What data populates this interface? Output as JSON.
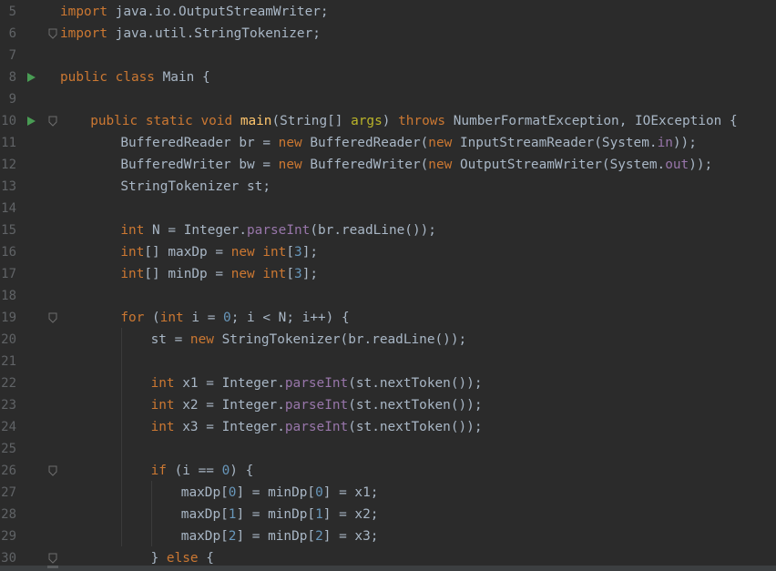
{
  "editor": {
    "lines": [
      {
        "n": "5",
        "indent": 0,
        "run": false,
        "fold": false,
        "tokens": [
          {
            "c": "k",
            "v": "import "
          },
          {
            "c": "t",
            "v": "java.io.OutputStreamWriter;"
          }
        ]
      },
      {
        "n": "6",
        "indent": 0,
        "run": false,
        "fold": true,
        "tokens": [
          {
            "c": "k",
            "v": "import "
          },
          {
            "c": "t",
            "v": "java.util.StringTokenizer;"
          }
        ]
      },
      {
        "n": "7",
        "indent": 0,
        "run": false,
        "fold": false,
        "tokens": []
      },
      {
        "n": "8",
        "indent": 0,
        "run": true,
        "fold": false,
        "tokens": [
          {
            "c": "k",
            "v": "public class "
          },
          {
            "c": "t",
            "v": "Main {"
          }
        ]
      },
      {
        "n": "9",
        "indent": 0,
        "run": false,
        "fold": false,
        "tokens": []
      },
      {
        "n": "10",
        "indent": 1,
        "run": true,
        "fold": true,
        "tokens": [
          {
            "c": "k",
            "v": "public static void "
          },
          {
            "c": "f",
            "v": "main"
          },
          {
            "c": "t",
            "v": "(String[] "
          },
          {
            "c": "p",
            "v": "args"
          },
          {
            "c": "t",
            "v": ") "
          },
          {
            "c": "k",
            "v": "throws "
          },
          {
            "c": "t",
            "v": "NumberFormatException, IOException {"
          }
        ]
      },
      {
        "n": "11",
        "indent": 2,
        "run": false,
        "fold": false,
        "tokens": [
          {
            "c": "t",
            "v": "BufferedReader br = "
          },
          {
            "c": "k",
            "v": "new "
          },
          {
            "c": "t",
            "v": "BufferedReader("
          },
          {
            "c": "k",
            "v": "new "
          },
          {
            "c": "t",
            "v": "InputStreamReader(System."
          },
          {
            "c": "s",
            "v": "in"
          },
          {
            "c": "t",
            "v": "));"
          }
        ]
      },
      {
        "n": "12",
        "indent": 2,
        "run": false,
        "fold": false,
        "tokens": [
          {
            "c": "t",
            "v": "BufferedWriter bw = "
          },
          {
            "c": "k",
            "v": "new "
          },
          {
            "c": "t",
            "v": "BufferedWriter("
          },
          {
            "c": "k",
            "v": "new "
          },
          {
            "c": "t",
            "v": "OutputStreamWriter(System."
          },
          {
            "c": "s",
            "v": "out"
          },
          {
            "c": "t",
            "v": "));"
          }
        ]
      },
      {
        "n": "13",
        "indent": 2,
        "run": false,
        "fold": false,
        "tokens": [
          {
            "c": "t",
            "v": "StringTokenizer st;"
          }
        ]
      },
      {
        "n": "14",
        "indent": 0,
        "run": false,
        "fold": false,
        "tokens": []
      },
      {
        "n": "15",
        "indent": 2,
        "run": false,
        "fold": false,
        "tokens": [
          {
            "c": "k",
            "v": "int "
          },
          {
            "c": "t",
            "v": "N = Integer."
          },
          {
            "c": "s",
            "v": "parseInt"
          },
          {
            "c": "t",
            "v": "(br.readLine());"
          }
        ]
      },
      {
        "n": "16",
        "indent": 2,
        "run": false,
        "fold": false,
        "tokens": [
          {
            "c": "k",
            "v": "int"
          },
          {
            "c": "t",
            "v": "[] maxDp = "
          },
          {
            "c": "k",
            "v": "new int"
          },
          {
            "c": "t",
            "v": "["
          },
          {
            "c": "n",
            "v": "3"
          },
          {
            "c": "t",
            "v": "];"
          }
        ]
      },
      {
        "n": "17",
        "indent": 2,
        "run": false,
        "fold": false,
        "tokens": [
          {
            "c": "k",
            "v": "int"
          },
          {
            "c": "t",
            "v": "[] minDp = "
          },
          {
            "c": "k",
            "v": "new int"
          },
          {
            "c": "t",
            "v": "["
          },
          {
            "c": "n",
            "v": "3"
          },
          {
            "c": "t",
            "v": "];"
          }
        ]
      },
      {
        "n": "18",
        "indent": 0,
        "run": false,
        "fold": false,
        "tokens": []
      },
      {
        "n": "19",
        "indent": 2,
        "run": false,
        "fold": true,
        "tokens": [
          {
            "c": "k",
            "v": "for "
          },
          {
            "c": "t",
            "v": "("
          },
          {
            "c": "k",
            "v": "int "
          },
          {
            "c": "t",
            "v": "i = "
          },
          {
            "c": "n",
            "v": "0"
          },
          {
            "c": "t",
            "v": "; i < N; i++) {"
          }
        ]
      },
      {
        "n": "20",
        "indent": 3,
        "run": false,
        "fold": false,
        "tokens": [
          {
            "c": "t",
            "v": "st = "
          },
          {
            "c": "k",
            "v": "new "
          },
          {
            "c": "t",
            "v": "StringTokenizer(br.readLine());"
          }
        ]
      },
      {
        "n": "21",
        "indent": 0,
        "run": false,
        "fold": false,
        "tokens": []
      },
      {
        "n": "22",
        "indent": 3,
        "run": false,
        "fold": false,
        "tokens": [
          {
            "c": "k",
            "v": "int "
          },
          {
            "c": "t",
            "v": "x1 = Integer."
          },
          {
            "c": "s",
            "v": "parseInt"
          },
          {
            "c": "t",
            "v": "(st.nextToken());"
          }
        ]
      },
      {
        "n": "23",
        "indent": 3,
        "run": false,
        "fold": false,
        "tokens": [
          {
            "c": "k",
            "v": "int "
          },
          {
            "c": "t",
            "v": "x2 = Integer."
          },
          {
            "c": "s",
            "v": "parseInt"
          },
          {
            "c": "t",
            "v": "(st.nextToken());"
          }
        ]
      },
      {
        "n": "24",
        "indent": 3,
        "run": false,
        "fold": false,
        "tokens": [
          {
            "c": "k",
            "v": "int "
          },
          {
            "c": "t",
            "v": "x3 = Integer."
          },
          {
            "c": "s",
            "v": "parseInt"
          },
          {
            "c": "t",
            "v": "(st.nextToken());"
          }
        ]
      },
      {
        "n": "25",
        "indent": 0,
        "run": false,
        "fold": false,
        "tokens": []
      },
      {
        "n": "26",
        "indent": 3,
        "run": false,
        "fold": true,
        "tokens": [
          {
            "c": "k",
            "v": "if "
          },
          {
            "c": "t",
            "v": "(i == "
          },
          {
            "c": "n",
            "v": "0"
          },
          {
            "c": "t",
            "v": ") {"
          }
        ]
      },
      {
        "n": "27",
        "indent": 4,
        "run": false,
        "fold": false,
        "tokens": [
          {
            "c": "t",
            "v": "maxDp["
          },
          {
            "c": "n",
            "v": "0"
          },
          {
            "c": "t",
            "v": "] = minDp["
          },
          {
            "c": "n",
            "v": "0"
          },
          {
            "c": "t",
            "v": "] = x1;"
          }
        ]
      },
      {
        "n": "28",
        "indent": 4,
        "run": false,
        "fold": false,
        "tokens": [
          {
            "c": "t",
            "v": "maxDp["
          },
          {
            "c": "n",
            "v": "1"
          },
          {
            "c": "t",
            "v": "] = minDp["
          },
          {
            "c": "n",
            "v": "1"
          },
          {
            "c": "t",
            "v": "] = x2;"
          }
        ]
      },
      {
        "n": "29",
        "indent": 4,
        "run": false,
        "fold": false,
        "tokens": [
          {
            "c": "t",
            "v": "maxDp["
          },
          {
            "c": "n",
            "v": "2"
          },
          {
            "c": "t",
            "v": "] = minDp["
          },
          {
            "c": "n",
            "v": "2"
          },
          {
            "c": "t",
            "v": "] = x3;"
          }
        ]
      },
      {
        "n": "30",
        "indent": 3,
        "run": false,
        "fold": true,
        "tokens": [
          {
            "c": "t",
            "v": "} "
          },
          {
            "c": "k",
            "v": "else "
          },
          {
            "c": "t",
            "v": "{"
          }
        ]
      }
    ]
  },
  "icons": {
    "run": "run-gutter-icon",
    "fold": "fold-marker-icon"
  },
  "colors": {
    "background": "#2b2b2b",
    "keyword": "#cc7832",
    "method": "#ffc66d",
    "static": "#9876aa",
    "number": "#6897bb",
    "text": "#a9b7c6",
    "parameter": "#bbb529",
    "line_number": "#606366",
    "run_icon": "#499c54"
  }
}
